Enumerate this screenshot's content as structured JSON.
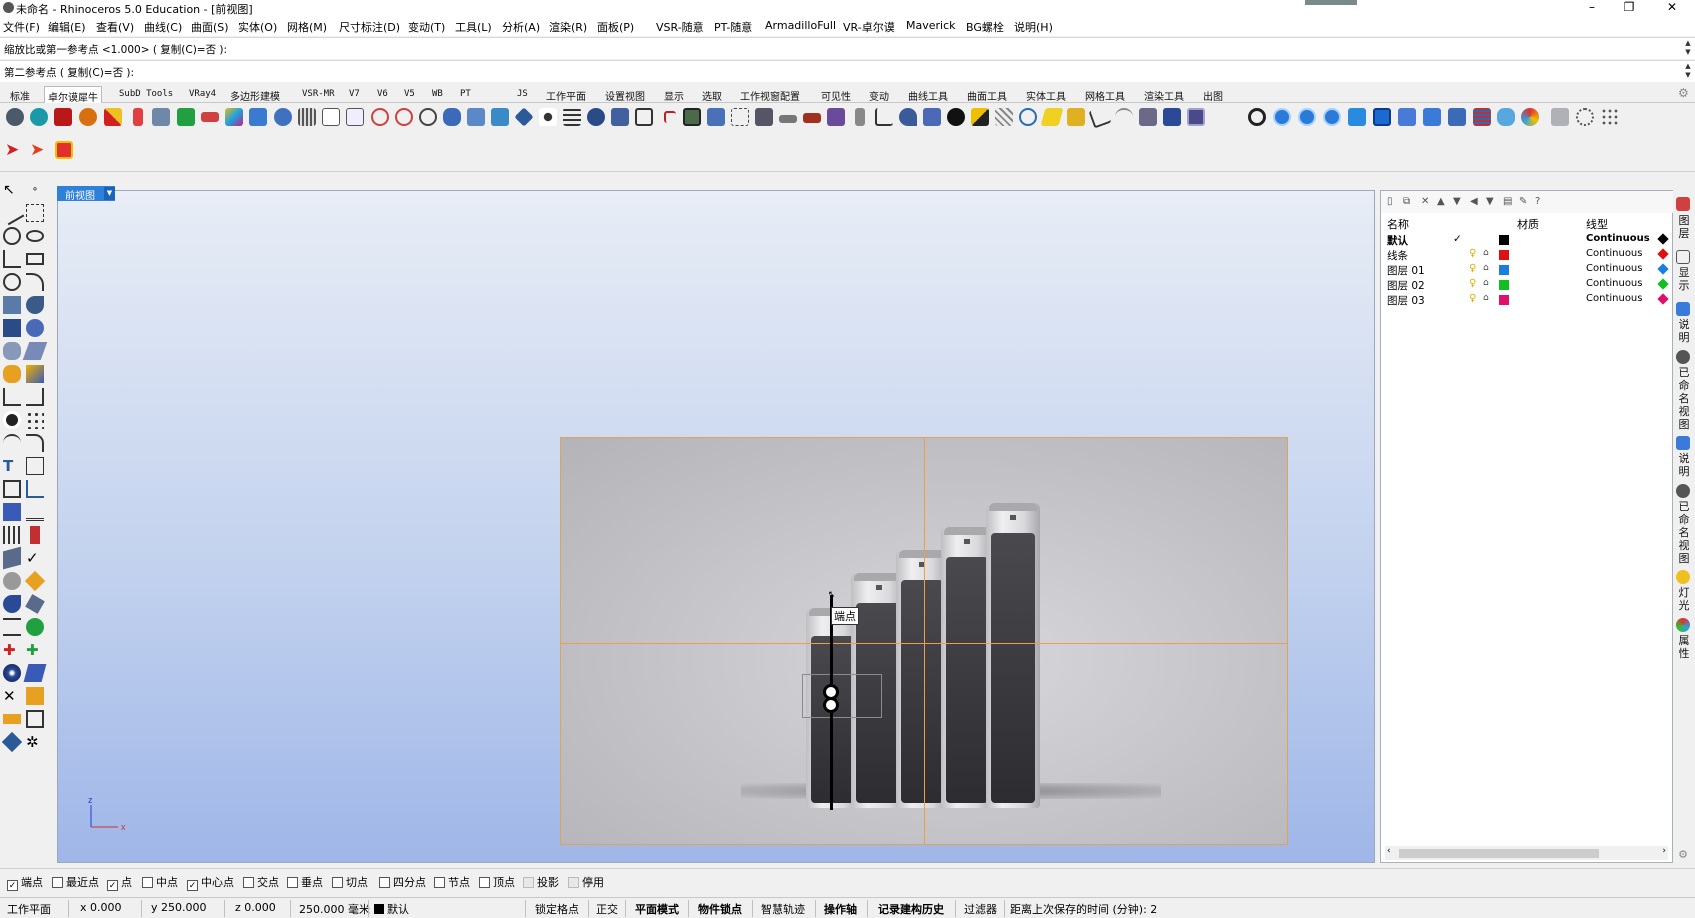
{
  "window": {
    "title": "未命名 - Rhinoceros 5.0 Education - [前视图]",
    "minimize": "–",
    "maximize": "❐",
    "close": "✕"
  },
  "menu": [
    "文件(F)",
    "编辑(E)",
    "查看(V)",
    "曲线(C)",
    "曲面(S)",
    "实体(O)",
    "网格(M)",
    "尺寸标注(D)",
    "变动(T)",
    "工具(L)",
    "分析(A)",
    "渲染(R)",
    "面板(P)",
    "VSR-随意",
    "PT-随意",
    "ArmadilloFull",
    "VR-卓尔谟",
    "Maverick",
    "BG螺栓",
    "说明(H)"
  ],
  "command": {
    "history": "缩放比或第一参考点 <1.000> ( 复制(C)=否 ):",
    "prompt": "第二参考点 ( 复制(C)=否 ):"
  },
  "tabs": [
    "标准",
    "卓尔谟犀牛",
    "SubD Tools",
    "VRay4",
    "多边形建模",
    "VSR-MR",
    "V7",
    "V6",
    "V5",
    "WB",
    "PT",
    "JS",
    "工作平面",
    "设置视图",
    "显示",
    "选取",
    "工作视窗配置",
    "可见性",
    "变动",
    "曲线工具",
    "曲面工具",
    "实体工具",
    "网格工具",
    "渲染工具",
    "出图"
  ],
  "active_tab": "卓尔谟犀牛",
  "viewport": {
    "name": "前视图",
    "osnap_tooltip": "端点",
    "axis_z": "z",
    "axis_x": "x"
  },
  "layers": {
    "headers": {
      "name": "名称",
      "material": "材质",
      "linetype": "线型"
    },
    "rows": [
      {
        "name": "默认",
        "current": "✓",
        "color": "#000000",
        "linetype": "Continuous"
      },
      {
        "name": "线条",
        "color": "#e01010",
        "linetype": "Continuous"
      },
      {
        "name": "图层 01",
        "color": "#1a7fe0",
        "linetype": "Continuous"
      },
      {
        "name": "图层 02",
        "color": "#10c020",
        "linetype": "Continuous"
      },
      {
        "name": "图层 03",
        "color": "#e0106a",
        "linetype": "Continuous"
      }
    ]
  },
  "right_tabs": [
    "图层",
    "显示",
    "说明",
    "已命名视图",
    "说明",
    "已命名视图",
    "灯光",
    "属性"
  ],
  "osnaps": [
    {
      "label": "端点",
      "checked": true
    },
    {
      "label": "最近点",
      "checked": false
    },
    {
      "label": "点",
      "checked": true
    },
    {
      "label": "中点",
      "checked": false
    },
    {
      "label": "中心点",
      "checked": true
    },
    {
      "label": "交点",
      "checked": false
    },
    {
      "label": "垂点",
      "checked": false
    },
    {
      "label": "切点",
      "checked": false
    },
    {
      "label": "四分点",
      "checked": false
    },
    {
      "label": "节点",
      "checked": false
    },
    {
      "label": "顶点",
      "checked": false
    },
    {
      "label": "投影",
      "checked": false
    },
    {
      "label": "停用",
      "checked": false
    }
  ],
  "status": {
    "cplane": "工作平面",
    "x": "x 0.000",
    "y": "y 250.000",
    "z": "z 0.000",
    "units": "250.000 毫米",
    "layer": "默认",
    "grid_snap": "锁定格点",
    "ortho": "正交",
    "planar": "平面模式",
    "osnap": "物件锁点",
    "smarttrack": "智慧轨迹",
    "gumball": "操作轴",
    "history": "记录建构历史",
    "filter": "过滤器",
    "autosave": "距离上次保存的时间 (分钟): 2"
  },
  "colors": {
    "accent": "#2e80d8",
    "crosshair": "#e8a050"
  }
}
